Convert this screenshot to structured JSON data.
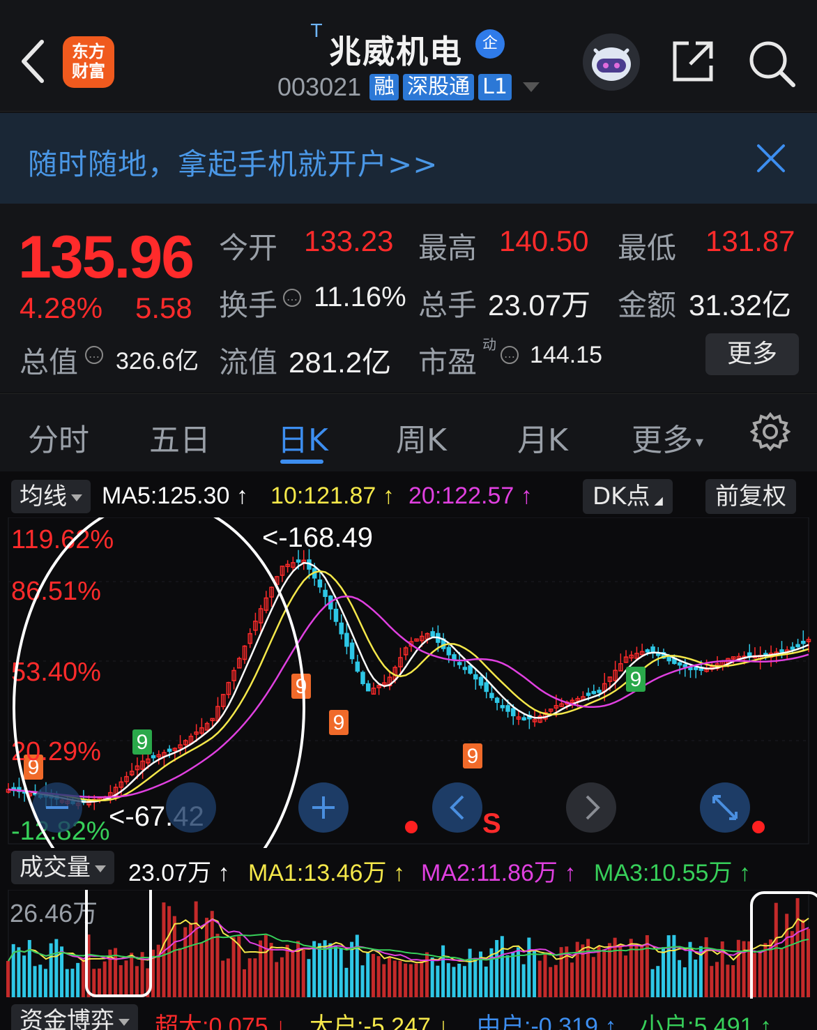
{
  "header": {
    "app_logo": "东方\n财富",
    "t_badge": "T",
    "stock_name": "兆威机电",
    "qi_badge": "企",
    "code": "003021",
    "tags": [
      "融",
      "深股通",
      "L1"
    ]
  },
  "banner": {
    "text": "随时随地，拿起手机就开户>>"
  },
  "quote": {
    "price": "135.96",
    "change_pct": "4.28%",
    "change_val": "5.58",
    "open_label": "今开",
    "open": "133.23",
    "high_label": "最高",
    "high": "140.50",
    "low_label": "最低",
    "low": "131.87",
    "turnover_label": "换手",
    "turnover": "11.16%",
    "volume_label": "总手",
    "volume": "23.07万",
    "amount_label": "金额",
    "amount": "31.32亿",
    "mktcap_label": "总值",
    "mktcap": "326.6亿",
    "float_label": "流值",
    "float": "281.2亿",
    "pe_label": "市盈",
    "pe_sup": "动",
    "pe": "144.15",
    "more": "更多"
  },
  "tabs": [
    "分时",
    "五日",
    "日K",
    "周K",
    "月K",
    "更多"
  ],
  "active_tab": "日K",
  "ma_row": {
    "selector": "均线",
    "ma5": "MA5:125.30",
    "ma10": "10:121.87",
    "ma20": "20:122.57",
    "arrow": "↑",
    "dk": "DK点",
    "adjust": "前复权"
  },
  "kline": {
    "y_labels": [
      "119.62%",
      "86.51%",
      "53.40%",
      "20.29%",
      "-12.82%"
    ],
    "high_marker": "<-168.49",
    "low_marker": "<-67.42",
    "signal_s": "S",
    "td_nines": [
      "9",
      "9",
      "9",
      "9",
      "9"
    ]
  },
  "volume_row": {
    "selector": "成交量",
    "vol": "23.07万",
    "ma1": "MA1:13.46万",
    "ma2": "MA2:11.86万",
    "ma3": "MA3:10.55万",
    "arrow": "↑",
    "y_label": "26.46万"
  },
  "fund_row": {
    "selector": "资金博弈",
    "super": "超大:0.075",
    "big": "大户:-5.247",
    "mid": "中户:-0.319",
    "small": "小户:5.491",
    "down": "↓",
    "up": "↑"
  },
  "colors": {
    "up": "#ff2b2b",
    "down": "#2ec7e6",
    "ma5": "#ffffff",
    "ma10": "#f5e84a",
    "ma20": "#e040e0",
    "accent": "#3d8ef0"
  }
}
